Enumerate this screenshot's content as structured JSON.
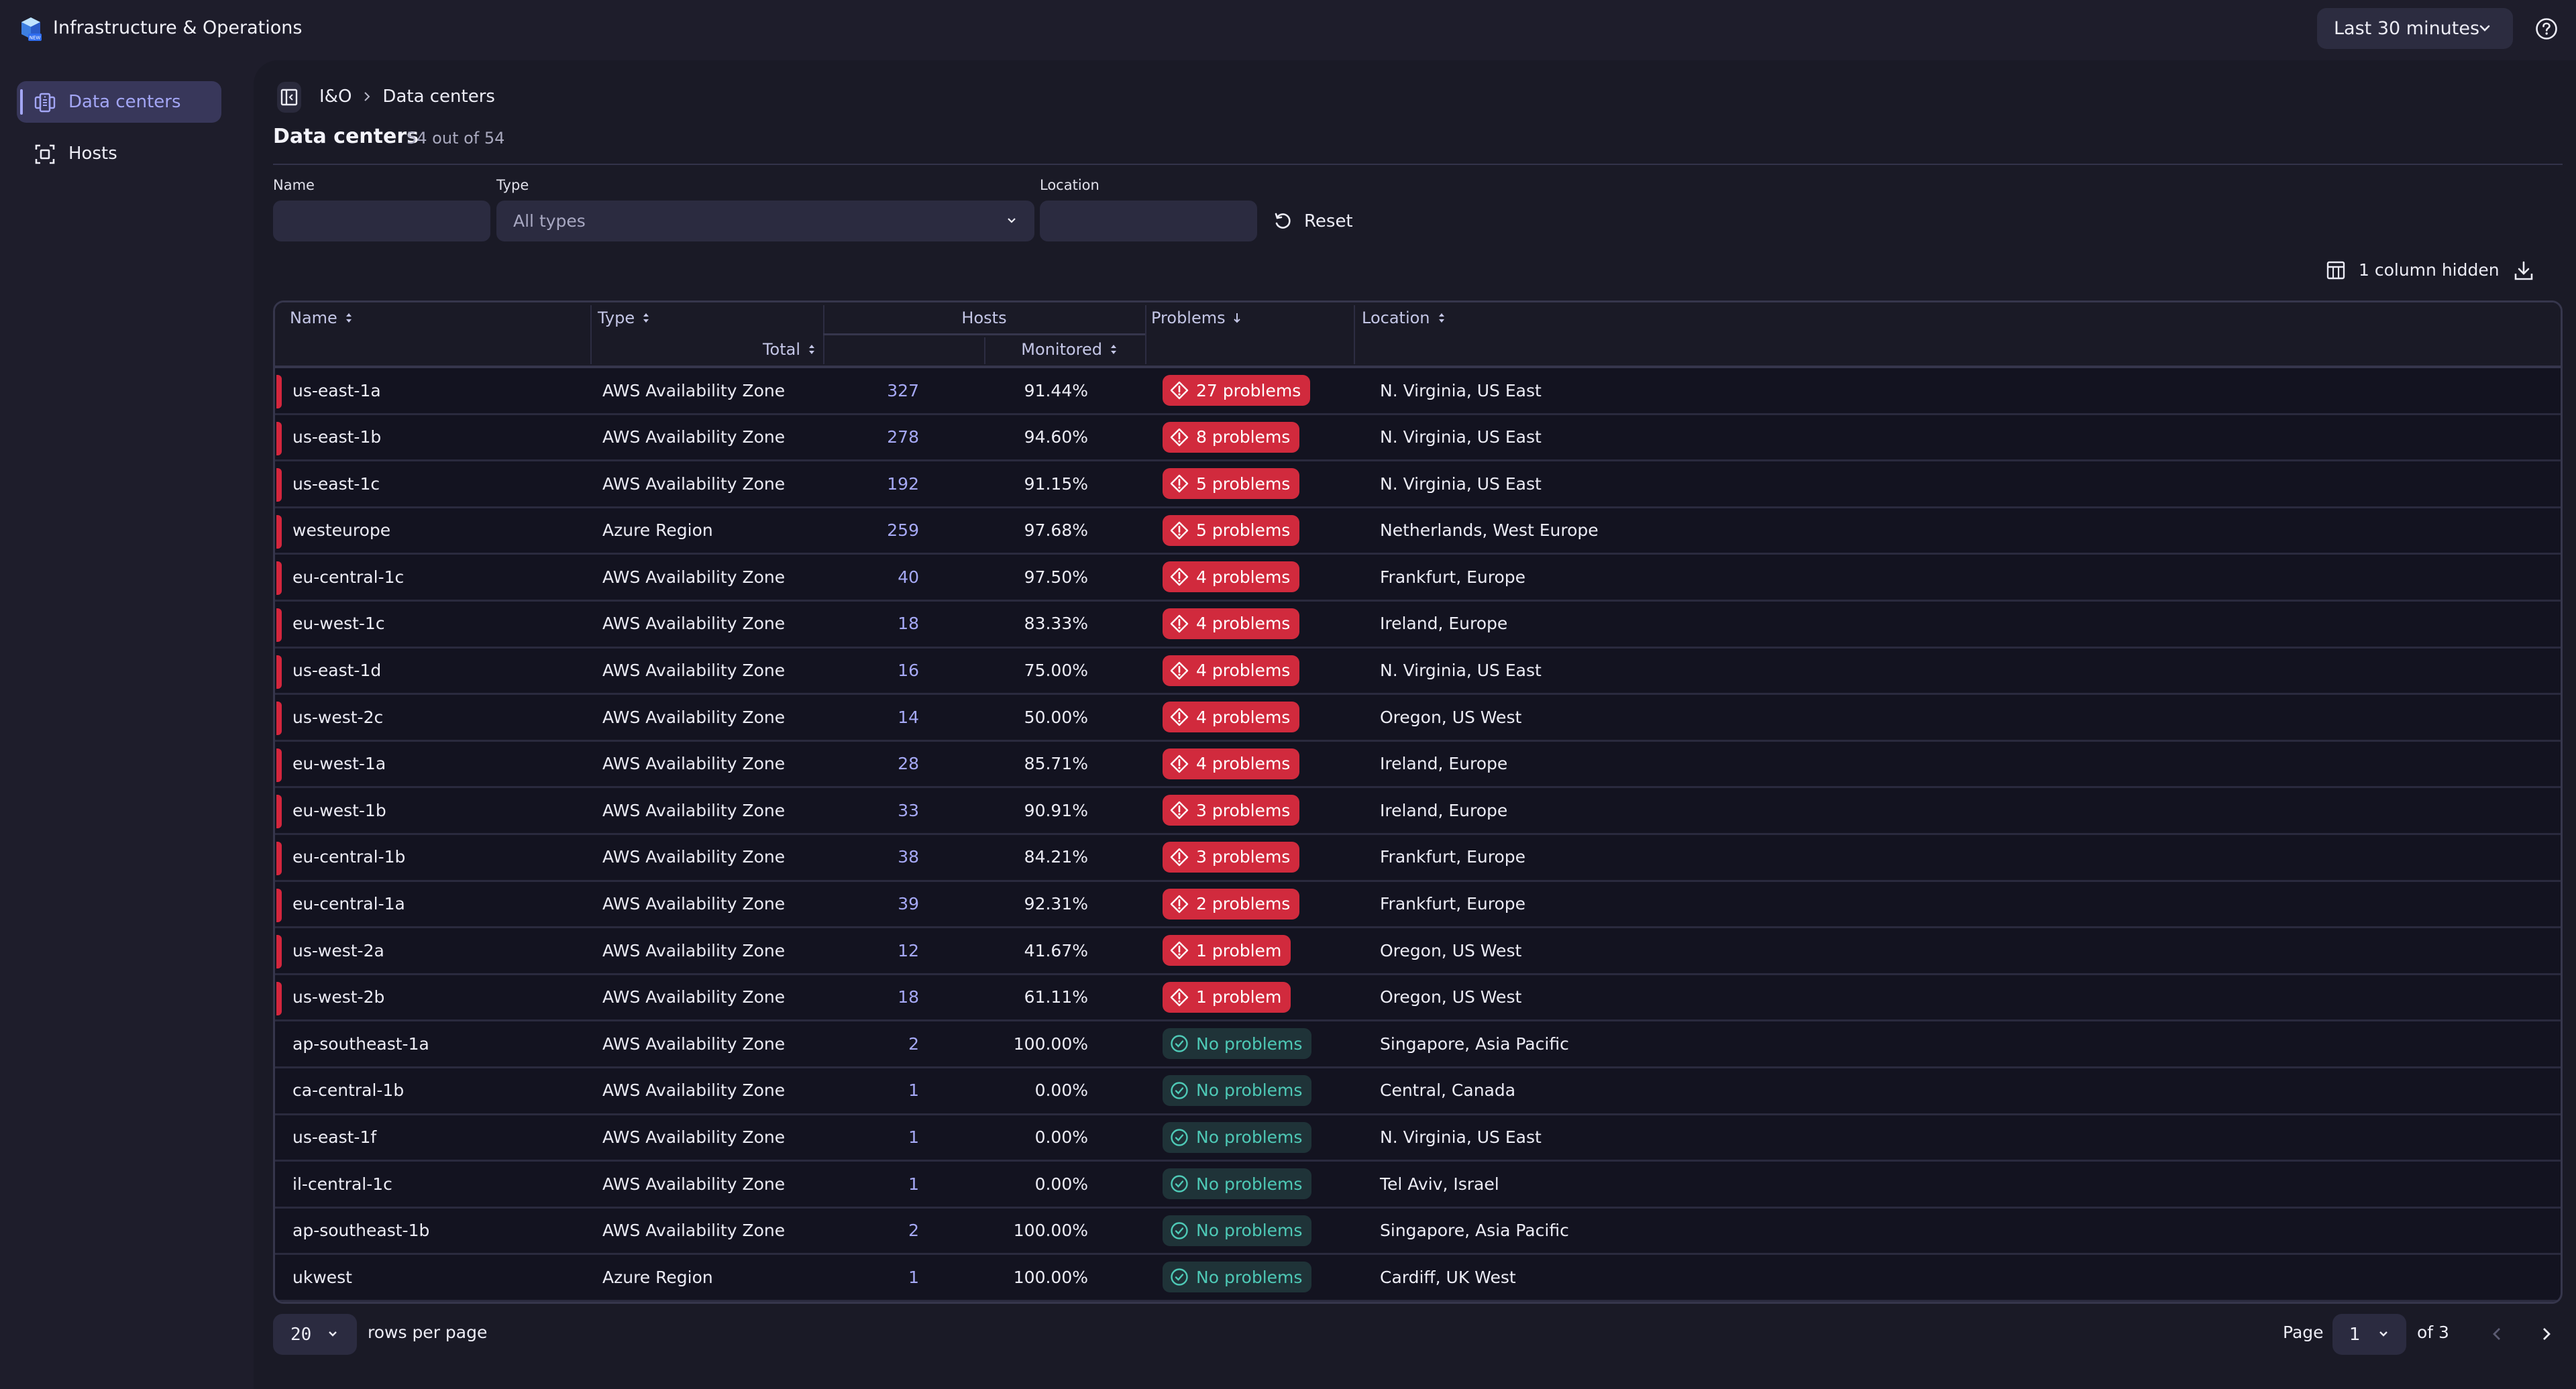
{
  "app": {
    "title": "Infrastructure & Operations",
    "logo_badge": "NEW",
    "time_range": "Last 30 minutes"
  },
  "sidebar": {
    "items": [
      {
        "label": "Data centers",
        "icon": "data-center-icon",
        "active": true
      },
      {
        "label": "Hosts",
        "icon": "host-icon",
        "active": false
      }
    ]
  },
  "breadcrumb": {
    "root": "I&O",
    "current": "Data centers"
  },
  "page": {
    "title": "Data centers",
    "count": "54 out of 54"
  },
  "filters": {
    "name_label": "Name",
    "name_value": "",
    "type_label": "Type",
    "type_value": "All types",
    "location_label": "Location",
    "location_value": "",
    "reset_label": "Reset"
  },
  "toolbar": {
    "columns_hidden": "1 column hidden"
  },
  "table": {
    "headers": {
      "name": "Name",
      "type": "Type",
      "hosts": "Hosts",
      "total": "Total",
      "monitored": "Monitored",
      "problems": "Problems",
      "location": "Location"
    },
    "rows": [
      {
        "name": "us-east-1a",
        "type": "AWS Availability Zone",
        "total": "327",
        "monitored": "91.44%",
        "problems": "27 problems",
        "status": "bad",
        "location": "N. Virginia, US East"
      },
      {
        "name": "us-east-1b",
        "type": "AWS Availability Zone",
        "total": "278",
        "monitored": "94.60%",
        "problems": "8 problems",
        "status": "bad",
        "location": "N. Virginia, US East"
      },
      {
        "name": "us-east-1c",
        "type": "AWS Availability Zone",
        "total": "192",
        "monitored": "91.15%",
        "problems": "5 problems",
        "status": "bad",
        "location": "N. Virginia, US East"
      },
      {
        "name": "westeurope",
        "type": "Azure Region",
        "total": "259",
        "monitored": "97.68%",
        "problems": "5 problems",
        "status": "bad",
        "location": "Netherlands, West Europe"
      },
      {
        "name": "eu-central-1c",
        "type": "AWS Availability Zone",
        "total": "40",
        "monitored": "97.50%",
        "problems": "4 problems",
        "status": "bad",
        "location": "Frankfurt, Europe"
      },
      {
        "name": "eu-west-1c",
        "type": "AWS Availability Zone",
        "total": "18",
        "monitored": "83.33%",
        "problems": "4 problems",
        "status": "bad",
        "location": "Ireland, Europe"
      },
      {
        "name": "us-east-1d",
        "type": "AWS Availability Zone",
        "total": "16",
        "monitored": "75.00%",
        "problems": "4 problems",
        "status": "bad",
        "location": "N. Virginia, US East"
      },
      {
        "name": "us-west-2c",
        "type": "AWS Availability Zone",
        "total": "14",
        "monitored": "50.00%",
        "problems": "4 problems",
        "status": "bad",
        "location": "Oregon, US West"
      },
      {
        "name": "eu-west-1a",
        "type": "AWS Availability Zone",
        "total": "28",
        "monitored": "85.71%",
        "problems": "4 problems",
        "status": "bad",
        "location": "Ireland, Europe"
      },
      {
        "name": "eu-west-1b",
        "type": "AWS Availability Zone",
        "total": "33",
        "monitored": "90.91%",
        "problems": "3 problems",
        "status": "bad",
        "location": "Ireland, Europe"
      },
      {
        "name": "eu-central-1b",
        "type": "AWS Availability Zone",
        "total": "38",
        "monitored": "84.21%",
        "problems": "3 problems",
        "status": "bad",
        "location": "Frankfurt, Europe"
      },
      {
        "name": "eu-central-1a",
        "type": "AWS Availability Zone",
        "total": "39",
        "monitored": "92.31%",
        "problems": "2 problems",
        "status": "bad",
        "location": "Frankfurt, Europe"
      },
      {
        "name": "us-west-2a",
        "type": "AWS Availability Zone",
        "total": "12",
        "monitored": "41.67%",
        "problems": "1 problem",
        "status": "bad",
        "location": "Oregon, US West"
      },
      {
        "name": "us-west-2b",
        "type": "AWS Availability Zone",
        "total": "18",
        "monitored": "61.11%",
        "problems": "1 problem",
        "status": "bad",
        "location": "Oregon, US West"
      },
      {
        "name": "ap-southeast-1a",
        "type": "AWS Availability Zone",
        "total": "2",
        "monitored": "100.00%",
        "problems": "No problems",
        "status": "good",
        "location": "Singapore, Asia Pacific"
      },
      {
        "name": "ca-central-1b",
        "type": "AWS Availability Zone",
        "total": "1",
        "monitored": "0.00%",
        "problems": "No problems",
        "status": "good",
        "location": "Central, Canada"
      },
      {
        "name": "us-east-1f",
        "type": "AWS Availability Zone",
        "total": "1",
        "monitored": "0.00%",
        "problems": "No problems",
        "status": "good",
        "location": "N. Virginia, US East"
      },
      {
        "name": "il-central-1c",
        "type": "AWS Availability Zone",
        "total": "1",
        "monitored": "0.00%",
        "problems": "No problems",
        "status": "good",
        "location": "Tel Aviv, Israel"
      },
      {
        "name": "ap-southeast-1b",
        "type": "AWS Availability Zone",
        "total": "2",
        "monitored": "100.00%",
        "problems": "No problems",
        "status": "good",
        "location": "Singapore, Asia Pacific"
      },
      {
        "name": "ukwest",
        "type": "Azure Region",
        "total": "1",
        "monitored": "100.00%",
        "problems": "No problems",
        "status": "good",
        "location": "Cardiff, UK West"
      }
    ]
  },
  "pagination": {
    "rows_per_page": "20",
    "rows_per_page_label": "rows per page",
    "page_label": "Page",
    "current_page": "1",
    "of_label": "of 3"
  },
  "colors": {
    "accent": "#a3a6f5",
    "problem": "#d12a3d",
    "ok": "#4ec9b6",
    "background": "#1a1a26"
  }
}
